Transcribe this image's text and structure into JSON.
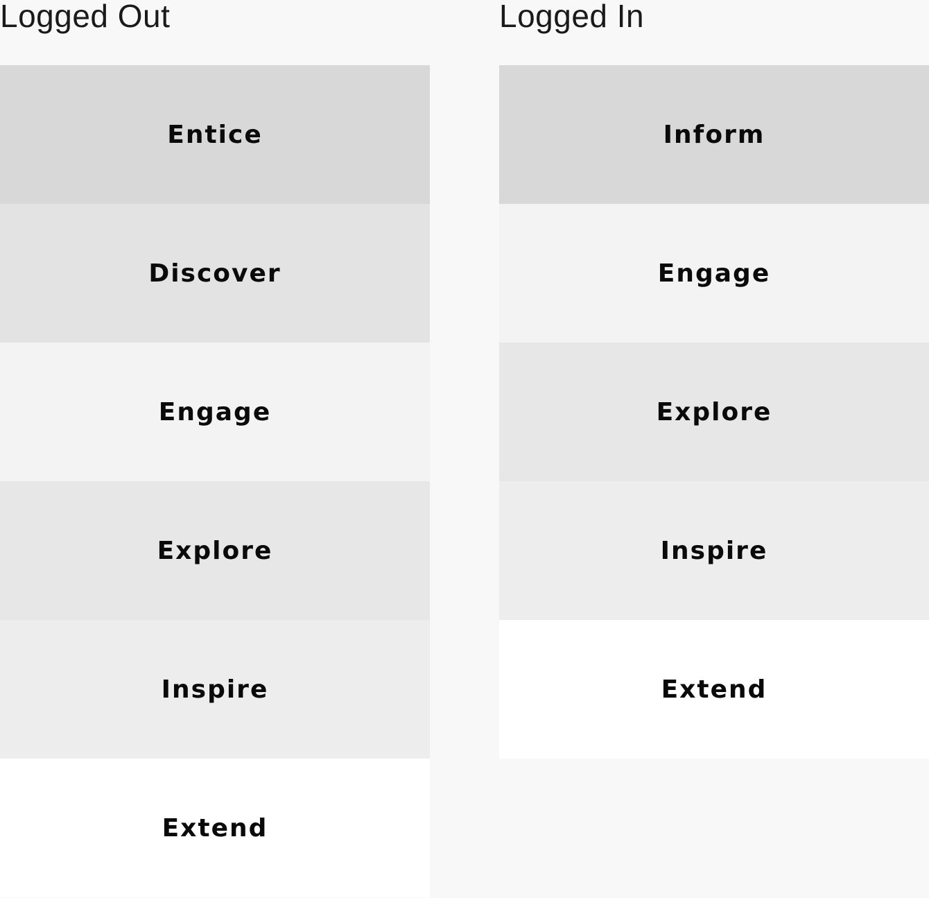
{
  "columns": [
    {
      "title": "Logged Out",
      "stages": [
        {
          "label": "Entice",
          "color": "#d8d8d8"
        },
        {
          "label": "Discover",
          "color": "#e3e3e3"
        },
        {
          "label": "Engage",
          "color": "#f3f3f3"
        },
        {
          "label": "Explore",
          "color": "#e7e7e7"
        },
        {
          "label": "Inspire",
          "color": "#ededed"
        },
        {
          "label": "Extend",
          "color": "#ffffff"
        }
      ]
    },
    {
      "title": "Logged In",
      "stages": [
        {
          "label": "Inform",
          "color": "#d8d8d8"
        },
        {
          "label": "Engage",
          "color": "#f3f3f3"
        },
        {
          "label": "Explore",
          "color": "#e7e7e7"
        },
        {
          "label": "Inspire",
          "color": "#ededed"
        },
        {
          "label": "Extend",
          "color": "#ffffff"
        }
      ]
    }
  ]
}
